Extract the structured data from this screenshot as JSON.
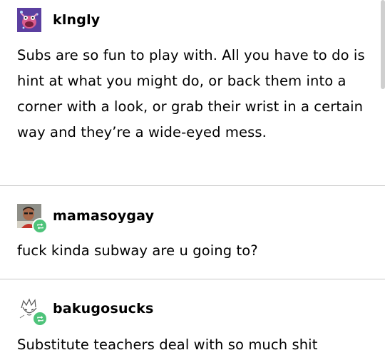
{
  "posts": [
    {
      "username": "klngly",
      "avatar_icon": "purple-creature-avatar-icon",
      "reblogged": false,
      "body": "Subs are so fun to play with. All you have to do is hint at what you might do, or back them into a corner with a look, or grab their wrist in a certain way and they’re a wide-eyed mess."
    },
    {
      "username": "mamasoygay",
      "avatar_icon": "person-photo-avatar-icon",
      "reblogged": true,
      "body": "fuck kinda subway are u going to?"
    },
    {
      "username": "bakugosucks",
      "avatar_icon": "sketch-drawing-avatar-icon",
      "reblogged": true,
      "body": "Substitute teachers deal with so much shit"
    }
  ],
  "colors": {
    "reblog_badge": "#4ec37a",
    "divider": "#c8c8c8",
    "avatar1_bg": "#5b3fa0"
  }
}
